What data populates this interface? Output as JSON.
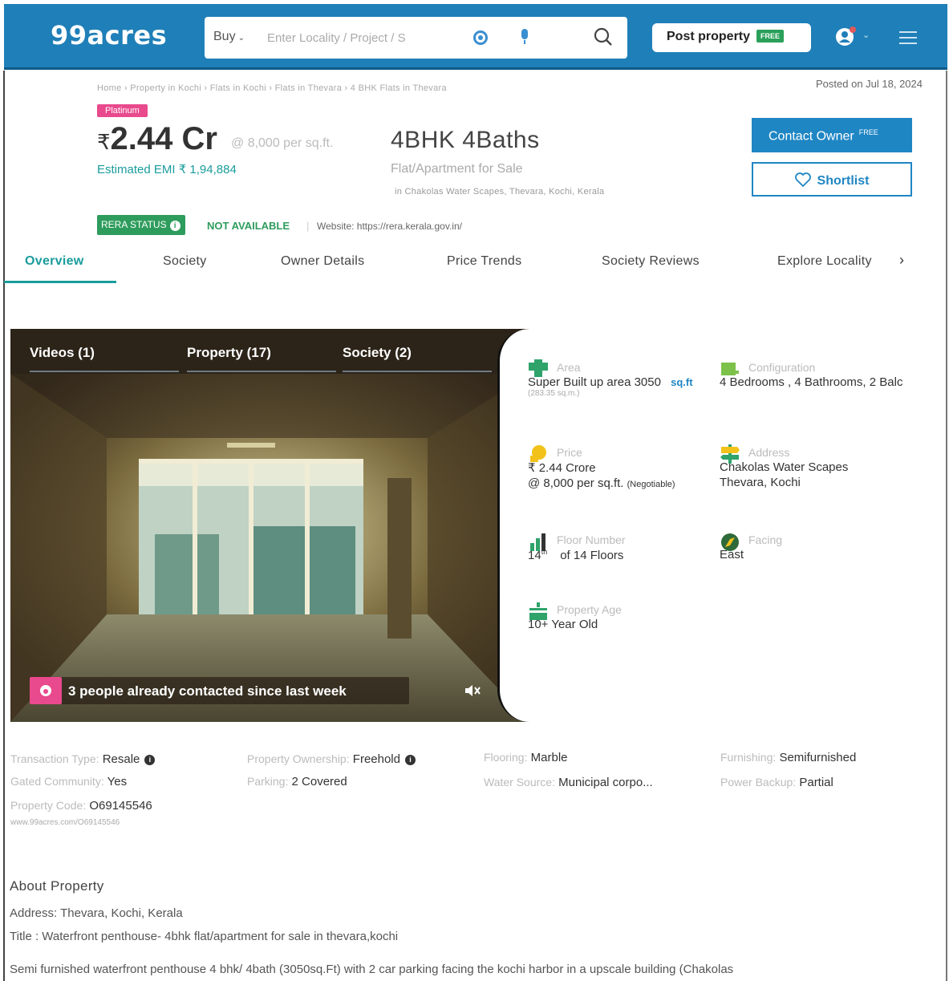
{
  "header": {
    "logo": "99acres",
    "buy_label": "Buy",
    "search_placeholder": "Enter Locality / Project / S",
    "post_property_label": "Post property",
    "free_badge": "FREE",
    "brand_color": "#1f7fb8"
  },
  "property": {
    "breadcrumb": "Home › Property in Kochi › Flats in Kochi › Flats in Thevara › 4 BHK Flats in Thevara",
    "posted": "Posted on Jul 18, 2024",
    "badge": "Platinum",
    "price_symbol": "₹",
    "price": "2.44 Cr",
    "per_sqft": "@ 8,000 per sq.ft.",
    "emi": "Estimated EMI ₹ 1,94,884",
    "config": "4BHK 4Baths",
    "type": "Flat/Apartment for Sale",
    "address_line": "in Chakolas Water Scapes, Thevara, Kochi, Kerala",
    "contact_label": "Contact Owner",
    "contact_free": "FREE",
    "shortlist_label": "Shortlist",
    "rera_label": "RERA STATUS",
    "rera_value": "NOT AVAILABLE",
    "separator": "|",
    "website": "Website: https://rera.kerala.gov.in/"
  },
  "tabs": [
    "Overview",
    "Society",
    "Owner Details",
    "Price Trends",
    "Society Reviews",
    "Explore Locality"
  ],
  "gallery": {
    "tabs": [
      "Videos (1)",
      "Property (17)",
      "Society (2)"
    ],
    "contacted": "3 people already contacted since last week"
  },
  "details": {
    "area_label": "Area",
    "area_value": "Super Built up area 3050",
    "area_unit": "sq.ft",
    "area_sqm": "(283.35 sq.m.)",
    "config_label": "Configuration",
    "config_value": "4 Bedrooms , 4 Bathrooms, 2 Balc",
    "price_label": "Price",
    "price_value": "₹ 2.44 Crore",
    "price_sqft": "@ 8,000 per sq.ft.",
    "negotiable": "(Negotiable)",
    "address_label": "Address",
    "address_value1": "Chakolas Water Scapes",
    "address_value2": "Thevara, Kochi",
    "floor_label": "Floor Number",
    "floor_num": "14",
    "floor_sup": "th",
    "floor_of": "of 14 Floors",
    "facing_label": "Facing",
    "facing_value": "East",
    "age_label": "Property Age",
    "age_value": "10+ Year Old"
  },
  "attributes": {
    "transaction_k": "Transaction Type:",
    "transaction_v": "Resale",
    "ownership_k": "Property Ownership:",
    "ownership_v": "Freehold",
    "flooring_k": "Flooring:",
    "flooring_v": "Marble",
    "furnishing_k": "Furnishing:",
    "furnishing_v": "Semifurnished",
    "gated_k": "Gated Community:",
    "gated_v": "Yes",
    "parking_k": "Parking:",
    "parking_v": "2 Covered",
    "water_k": "Water Source:",
    "water_v": "Municipal corpo...",
    "power_k": "Power Backup:",
    "power_v": "Partial",
    "code_k": "Property Code:",
    "code_v": "O69145546",
    "url": "www.99acres.com/O69145546"
  },
  "about": {
    "heading": "About Property",
    "address": "Address: Thevara, Kochi, Kerala",
    "title": "Title : Waterfront penthouse- 4bhk flat/apartment for sale in thevara,kochi",
    "desc": "Semi furnished waterfront penthouse 4 bhk/ 4bath (3050sq.Ft) with 2 car parking facing the kochi harbor in a upscale building (Chakolas"
  }
}
